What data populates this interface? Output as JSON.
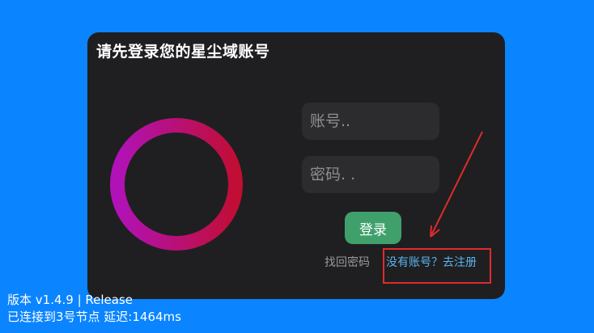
{
  "panel": {
    "title": "请先登录您的星尘域账号"
  },
  "form": {
    "account_placeholder": "账号..",
    "password_placeholder": "密码. .",
    "login_label": "登录",
    "forgot_label": "找回密码",
    "register_label": "没有账号？去注册"
  },
  "footer": {
    "version": "版本 v1.4.9 | Release",
    "connection": "已连接到3号节点 延迟:1464ms"
  },
  "colors": {
    "background": "#0a84ff",
    "panel": "#1f1f21",
    "input": "#2c2c2e",
    "login_button": "#40a06c",
    "register_link": "#5ab4f0",
    "annotation": "#e02b2b",
    "ring_gradient": [
      "#b112b8",
      "#c00e35"
    ]
  }
}
